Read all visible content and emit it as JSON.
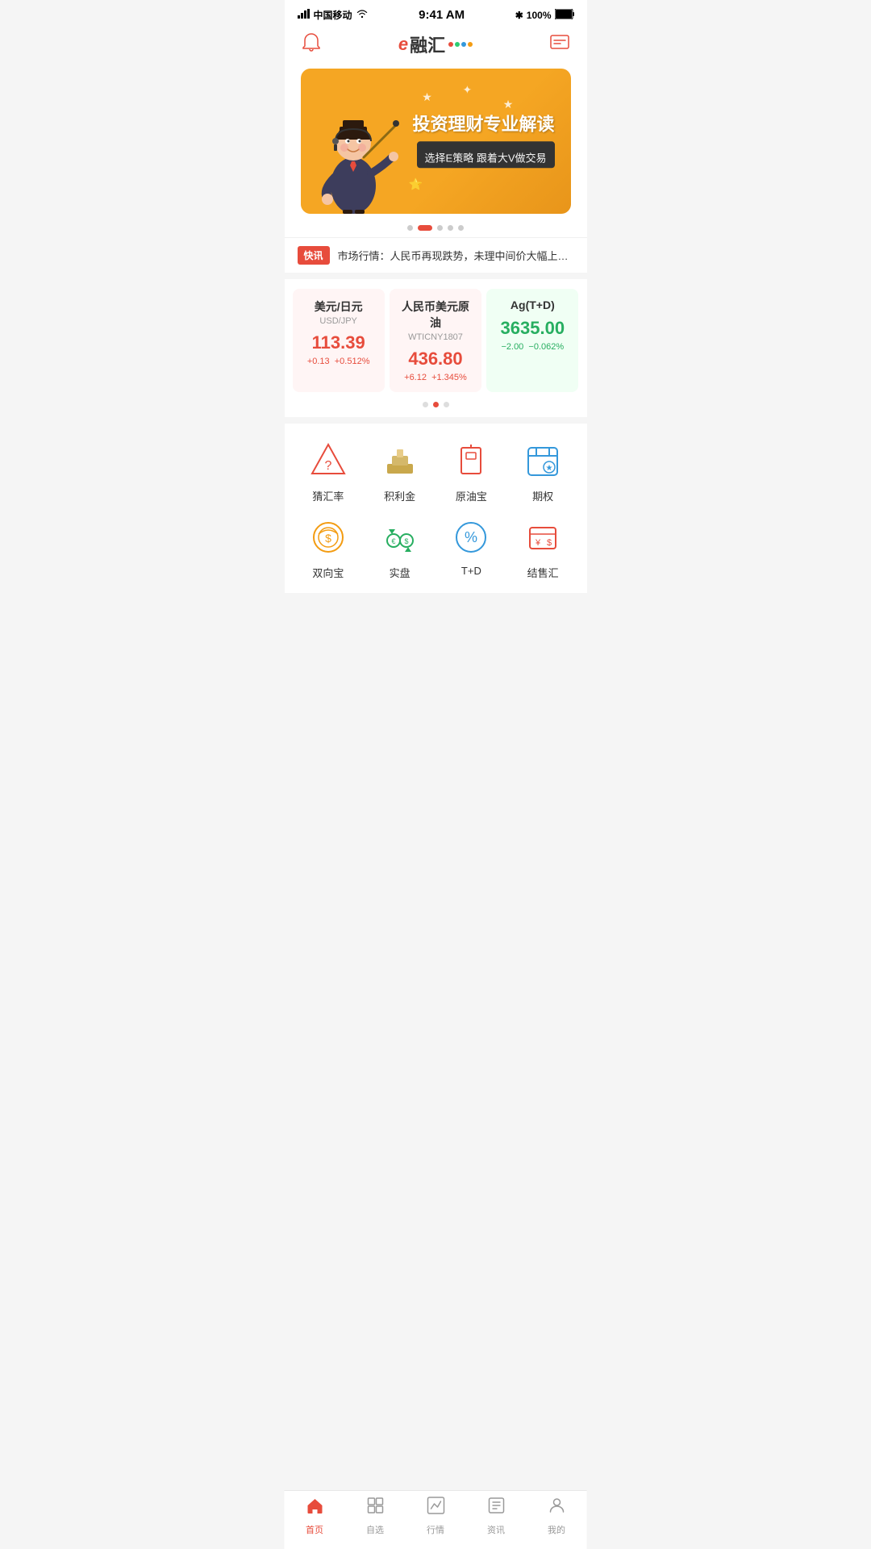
{
  "statusBar": {
    "carrier": "中国移动",
    "time": "9:41 AM",
    "battery": "100%"
  },
  "header": {
    "logoE": "e",
    "logoText": "融汇",
    "notificationLabel": "notification",
    "messageLabel": "message"
  },
  "banner": {
    "title": "投资理财专业解读",
    "subtitle": "选择E策略 跟着大V做交易",
    "dots": [
      false,
      true,
      false,
      false,
      false
    ]
  },
  "news": {
    "badge": "快讯",
    "text": "市场行情：人民币再现跌势，未理中间价大幅上调到..."
  },
  "market": {
    "cards": [
      {
        "name": "美元/日元",
        "code": "USD/JPY",
        "price": "113.39",
        "change1": "+0.13",
        "change2": "+0.512%",
        "direction": "up"
      },
      {
        "name": "人民币美元原油",
        "code": "WTICNY1807",
        "price": "436.80",
        "change1": "+6.12",
        "change2": "+1.345%",
        "direction": "up"
      },
      {
        "name": "Ag(T+D)",
        "code": "",
        "price": "3635.00",
        "change1": "−2.00",
        "change2": "−0.062%",
        "direction": "down"
      }
    ],
    "dots": [
      false,
      true,
      false
    ]
  },
  "menu": {
    "items": [
      {
        "label": "猜汇率",
        "icon": "guess",
        "color": "#e74c3c"
      },
      {
        "label": "积利金",
        "icon": "gold",
        "color": "#f39c12"
      },
      {
        "label": "原油宝",
        "icon": "oil",
        "color": "#e74c3c"
      },
      {
        "label": "期权",
        "icon": "calendar",
        "color": "#3498db"
      },
      {
        "label": "双向宝",
        "icon": "shield",
        "color": "#f39c12"
      },
      {
        "label": "实盘",
        "icon": "exchange",
        "color": "#27ae60"
      },
      {
        "label": "T+D",
        "icon": "percent",
        "color": "#3498db"
      },
      {
        "label": "结售汇",
        "icon": "currency",
        "color": "#e74c3c"
      }
    ]
  },
  "bottomNav": {
    "items": [
      {
        "label": "首页",
        "icon": "home",
        "active": true
      },
      {
        "label": "自选",
        "icon": "grid",
        "active": false
      },
      {
        "label": "行情",
        "icon": "chart",
        "active": false
      },
      {
        "label": "资讯",
        "icon": "news",
        "active": false
      },
      {
        "label": "我的",
        "icon": "user",
        "active": false
      }
    ]
  }
}
